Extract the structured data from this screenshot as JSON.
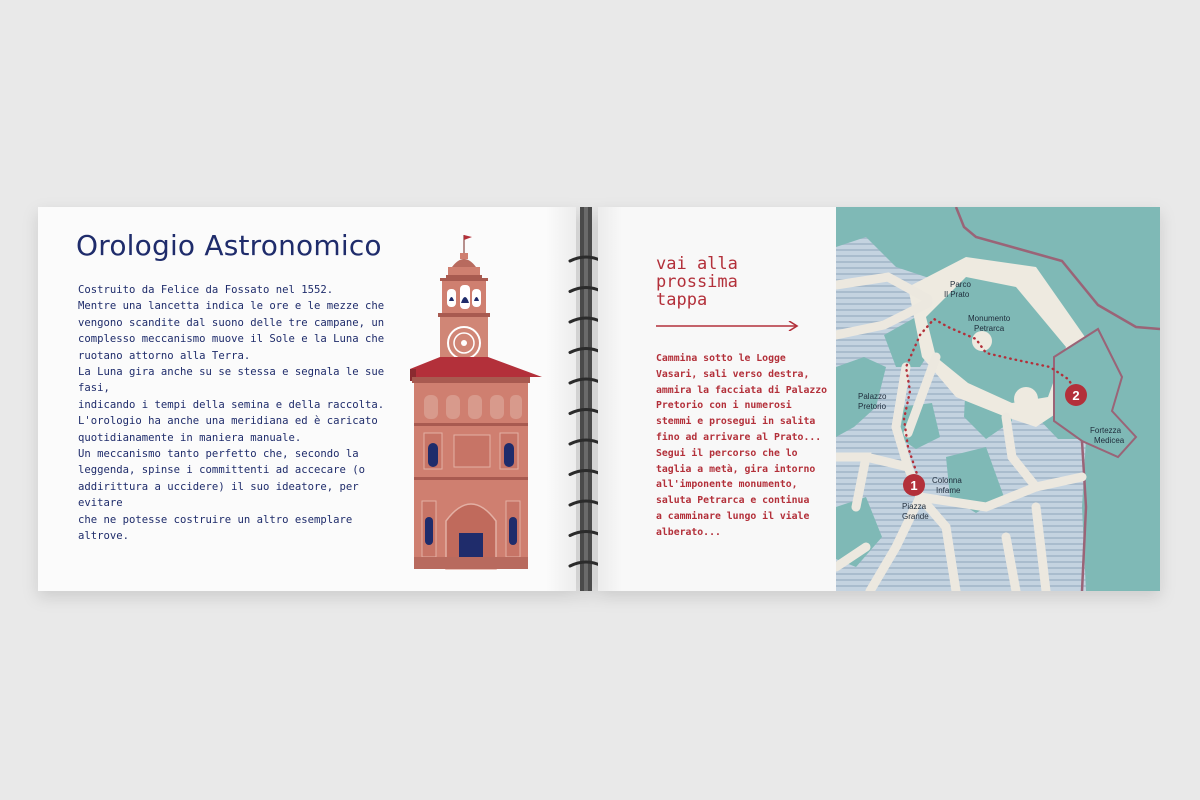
{
  "left_page": {
    "title": "Orologio Astronomico",
    "lines": [
      "Costruito da Felice da Fossato nel 1552.",
      "Mentre una lancetta indica le ore e le mezze che",
      "vengono scandite dal suono delle tre campane, un",
      "complesso meccanismo muove il Sole e la Luna che",
      "ruotano attorno alla Terra.",
      "La Luna gira anche su se stessa e segnala le sue fasi,",
      "indicando i tempi della semina e della raccolta.",
      "L'orologio ha anche una meridiana ed è caricato",
      "quotidianamente in maniera manuale.",
      "Un meccanismo tanto perfetto che, secondo la",
      "leggenda, spinse i committenti ad accecare (o",
      "addirittura a uccidere) il suo ideatore, per evitare",
      "che ne potesse costruire un altro esemplare altrove."
    ]
  },
  "right_page": {
    "heading_lines": [
      "vai alla",
      "prossima",
      "tappa"
    ],
    "route_lines": [
      "Cammina sotto le Logge",
      "Vasari, sali verso destra,",
      "ammira la facciata di Palazzo",
      "Pretorio con i numerosi",
      "stemmi e prosegui in salita",
      "fino ad arrivare al Prato...",
      "Segui il percorso che lo",
      "taglia a metà, gira intorno",
      "all'imponente monumento,",
      "saluta Petrarca e continua",
      "a camminare lungo il viale",
      "alberato..."
    ]
  },
  "map": {
    "labels": {
      "parco_1": "Parco",
      "parco_2": "Il Prato",
      "monumento_1": "Monumento",
      "monumento_2": "Petrarca",
      "palazzo_1": "Palazzo",
      "palazzo_2": "Pretorio",
      "fortezza_1": "Fortezza",
      "fortezza_2": "Medicea",
      "colonna_1": "Colonna",
      "colonna_2": "Infame",
      "piazza_1": "Piazza",
      "piazza_2": "Grande"
    },
    "markers": [
      "1",
      "2"
    ]
  },
  "colors": {
    "navy": "#1f2c6b",
    "red": "#b3303a",
    "teal": "#7fb9b6",
    "terracotta": "#cf7f70",
    "street": "#ece8df",
    "stripe_bg": "#b8c9d8"
  },
  "icons": [
    "clock-tower-illustration",
    "spiral-binding",
    "arrow-right-icon",
    "city-map"
  ]
}
